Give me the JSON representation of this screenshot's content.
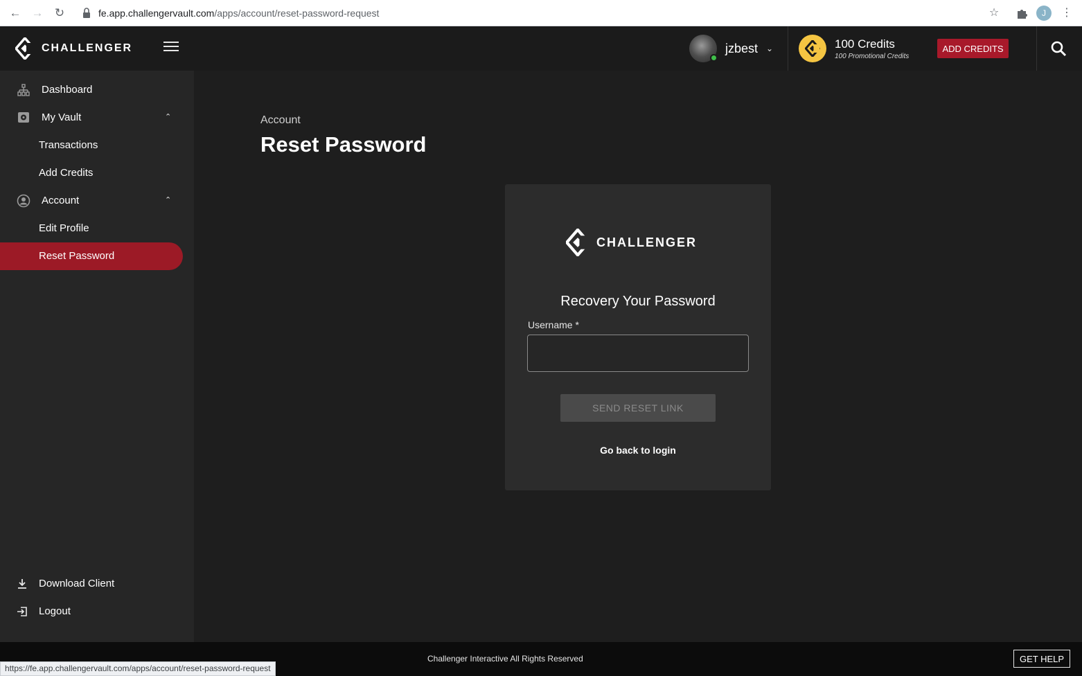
{
  "browser": {
    "url_host": "fe.app.challengervault.com",
    "url_path": "/apps/account/reset-password-request",
    "profile_initial": "J",
    "status_url": "https://fe.app.challengervault.com/apps/account/reset-password-request"
  },
  "header": {
    "brand": "CHALLENGER",
    "username": "jzbest",
    "credits": "100 Credits",
    "promo_credits": "100 Promotional Credits",
    "add_credits_label": "ADD CREDITS"
  },
  "sidebar": {
    "items": [
      {
        "label": "Dashboard"
      },
      {
        "label": "My Vault"
      },
      {
        "label": "Transactions"
      },
      {
        "label": "Add Credits"
      },
      {
        "label": "Account"
      },
      {
        "label": "Edit Profile"
      },
      {
        "label": "Reset Password"
      }
    ],
    "bottom": [
      {
        "label": "Download Client"
      },
      {
        "label": "Logout"
      }
    ]
  },
  "main": {
    "breadcrumb": "Account",
    "title": "Reset Password",
    "card": {
      "brand": "CHALLENGER",
      "heading": "Recovery Your Password",
      "username_label": "Username *",
      "username_value": "",
      "send_label": "SEND RESET LINK",
      "back_label": "Go back to login"
    }
  },
  "footer": {
    "copyright": "Challenger Interactive All Rights Reserved",
    "help_label": "GET HELP"
  },
  "colors": {
    "accent_red": "#9c1a26",
    "coin_yellow": "#f5c542",
    "online_green": "#3fbf4a"
  }
}
